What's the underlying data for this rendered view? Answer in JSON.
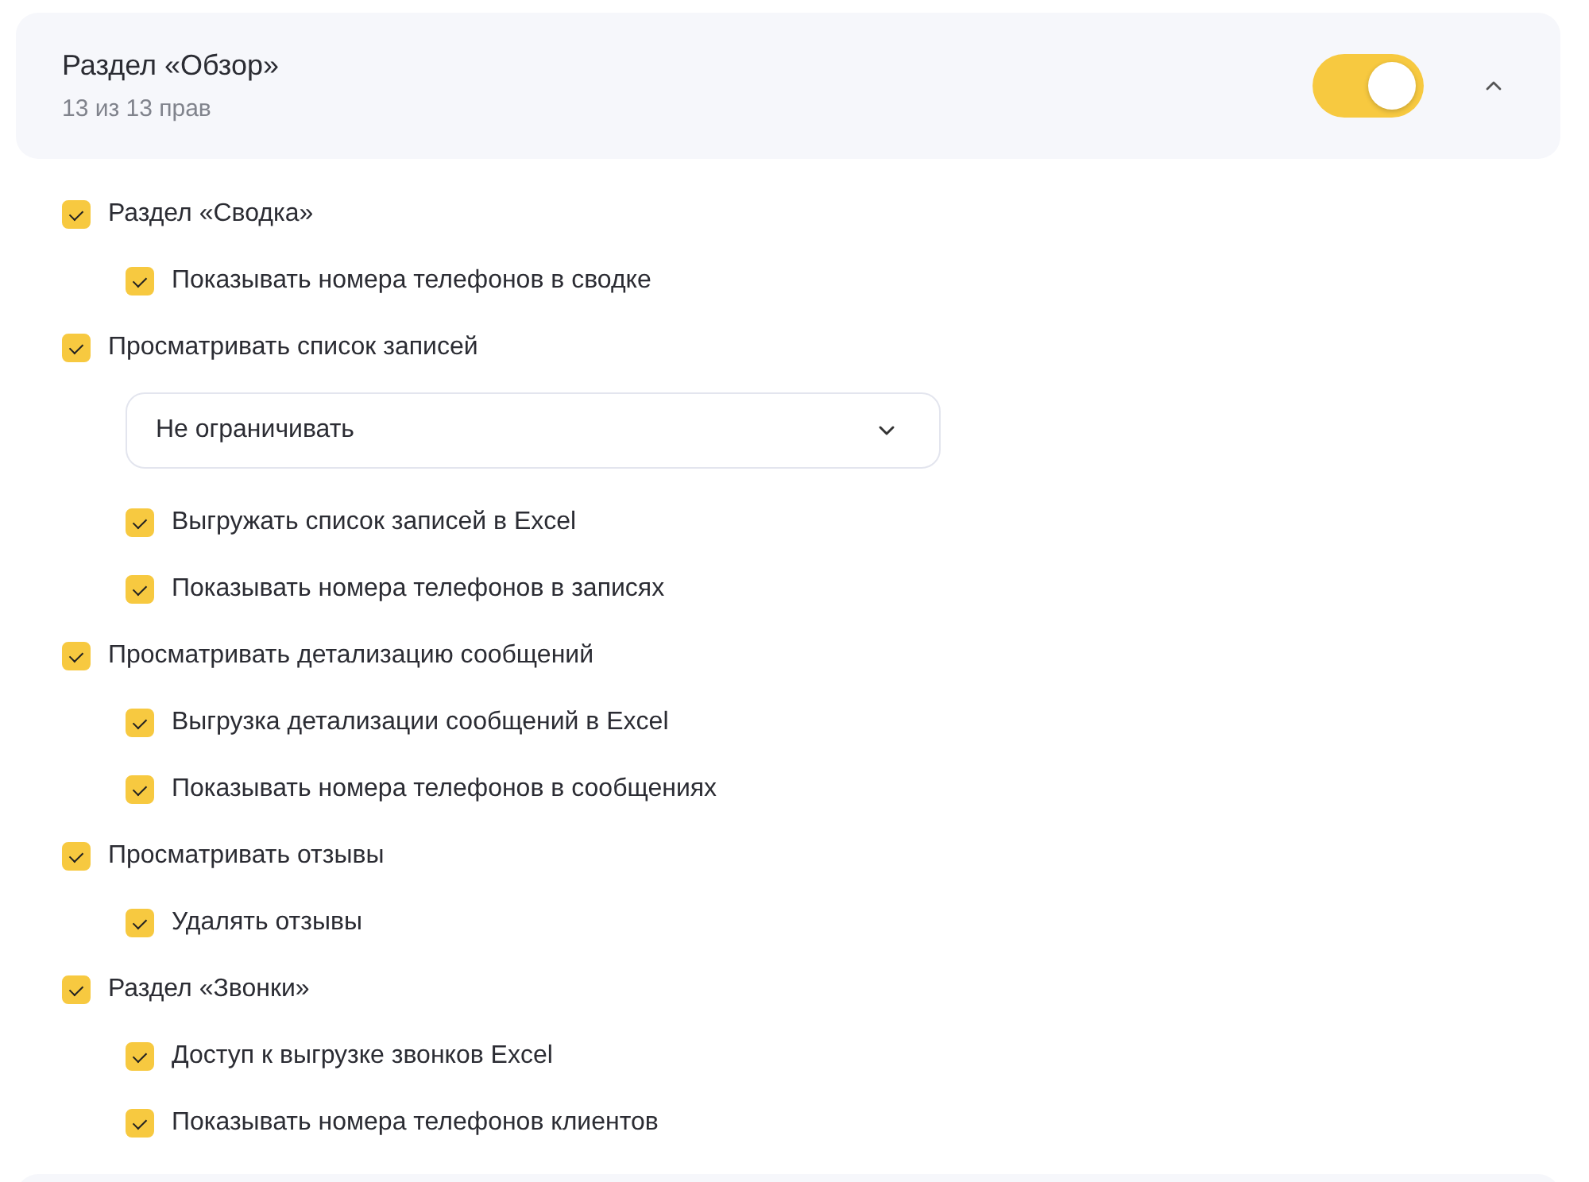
{
  "section": {
    "title": "Раздел «Обзор»",
    "subtitle": "13 из 13 прав",
    "on": true,
    "expanded": true
  },
  "items": [
    {
      "label": "Раздел «Сводка»",
      "checked": true,
      "children": [
        {
          "label": "Показывать номера телефонов в сводке",
          "checked": true
        }
      ]
    },
    {
      "label": "Просматривать список записей",
      "checked": true,
      "select": {
        "value": "Не ограничивать"
      },
      "children": [
        {
          "label": "Выгружать список записей в Excel",
          "checked": true
        },
        {
          "label": "Показывать номера телефонов в записях",
          "checked": true
        }
      ]
    },
    {
      "label": "Просматривать детализацию сообщений",
      "checked": true,
      "children": [
        {
          "label": "Выгрузка детализации сообщений в Excel",
          "checked": true
        },
        {
          "label": "Показывать номера телефонов в сообщениях",
          "checked": true
        }
      ]
    },
    {
      "label": "Просматривать отзывы",
      "checked": true,
      "children": [
        {
          "label": "Удалять отзывы",
          "checked": true
        }
      ]
    },
    {
      "label": "Раздел «Звонки»",
      "checked": true,
      "children": [
        {
          "label": "Доступ к выгрузке звонков Excel",
          "checked": true
        },
        {
          "label": "Показывать номера телефонов клиентов",
          "checked": true
        }
      ]
    }
  ]
}
